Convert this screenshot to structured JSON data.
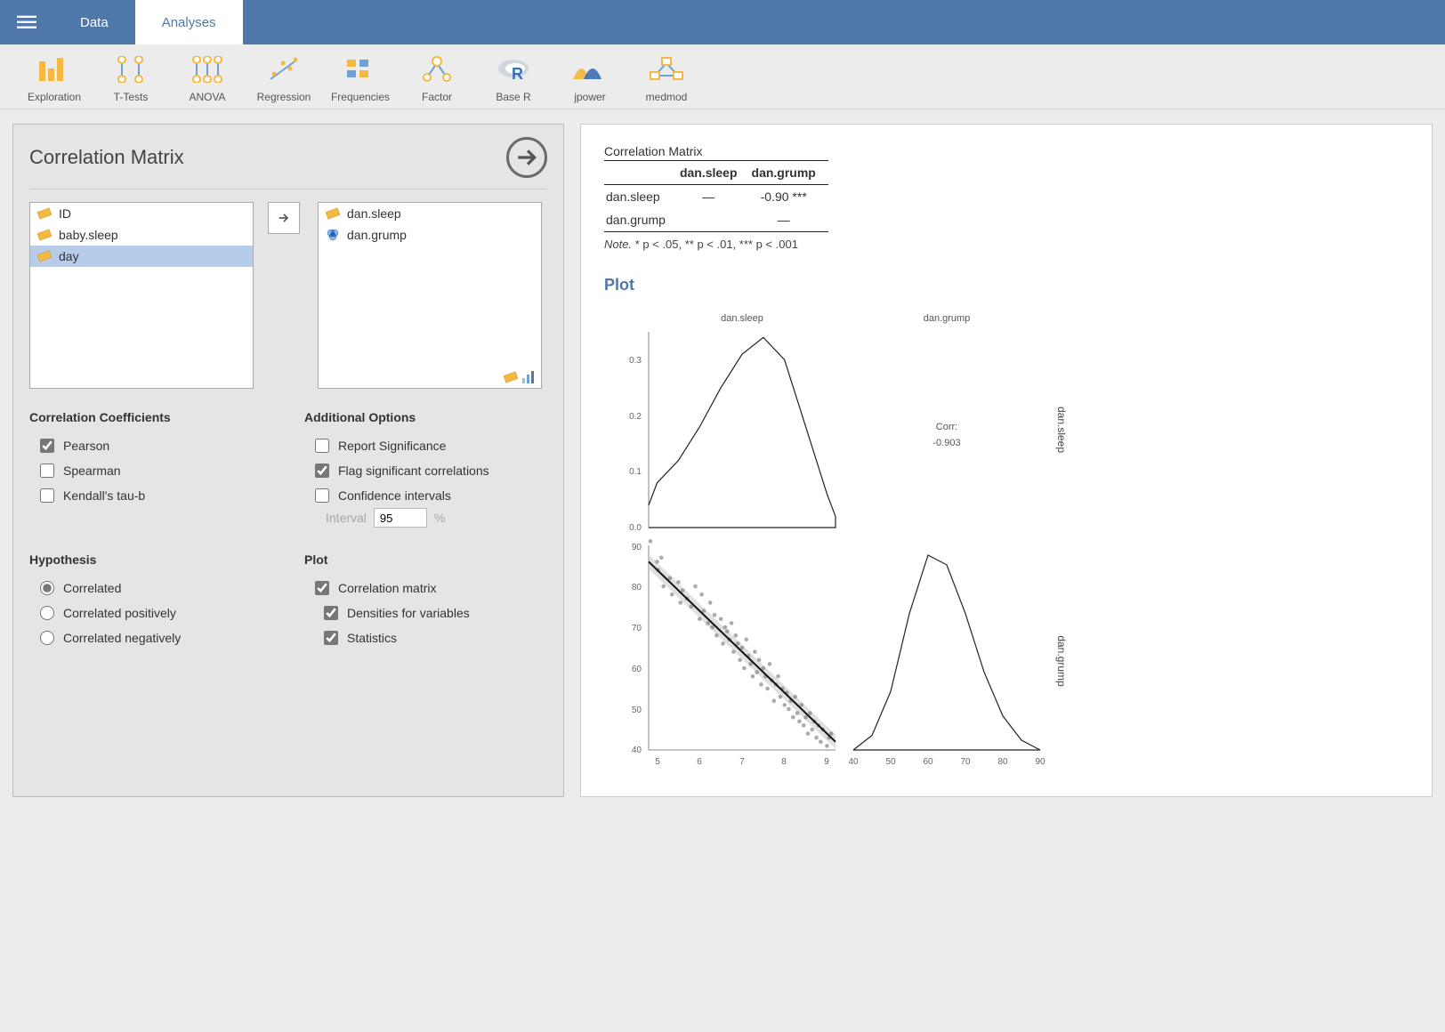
{
  "topbar": {
    "tabs": [
      {
        "label": "Data"
      },
      {
        "label": "Analyses"
      }
    ],
    "active_tab": 1
  },
  "toolbar": [
    {
      "label": "Exploration"
    },
    {
      "label": "T-Tests"
    },
    {
      "label": "ANOVA"
    },
    {
      "label": "Regression"
    },
    {
      "label": "Frequencies"
    },
    {
      "label": "Factor"
    },
    {
      "label": "Base R"
    },
    {
      "label": "jpower"
    },
    {
      "label": "medmod"
    }
  ],
  "analysis": {
    "title": "Correlation Matrix",
    "available_vars": [
      {
        "name": "ID",
        "type": "scale",
        "selected": false
      },
      {
        "name": "baby.sleep",
        "type": "scale",
        "selected": false
      },
      {
        "name": "day",
        "type": "scale",
        "selected": true
      }
    ],
    "selected_vars": [
      {
        "name": "dan.sleep",
        "type": "scale"
      },
      {
        "name": "dan.grump",
        "type": "nominal"
      }
    ],
    "corr_coeff": {
      "header": "Correlation Coefficients",
      "pearson": "Pearson",
      "spearman": "Spearman",
      "kendall": "Kendall's tau-b",
      "pearson_checked": true,
      "spearman_checked": false,
      "kendall_checked": false
    },
    "addl": {
      "header": "Additional Options",
      "report_sig": "Report Significance",
      "flag": "Flag significant correlations",
      "ci": "Confidence intervals",
      "report_sig_checked": false,
      "flag_checked": true,
      "ci_checked": false,
      "interval_label": "Interval",
      "interval_value": "95",
      "interval_suffix": "%"
    },
    "hypothesis": {
      "header": "Hypothesis",
      "correlated": "Correlated",
      "pos": "Correlated positively",
      "neg": "Correlated negatively",
      "selected": "correlated"
    },
    "plot_opts": {
      "header": "Plot",
      "matrix": "Correlation matrix",
      "densities": "Densities for variables",
      "stats": "Statistics",
      "matrix_checked": true,
      "densities_checked": true,
      "stats_checked": true
    }
  },
  "results": {
    "table_title": "Correlation Matrix",
    "cols": [
      "dan.sleep",
      "dan.grump"
    ],
    "rows": [
      {
        "name": "dan.sleep",
        "cells": [
          "—",
          "-0.90 ***"
        ]
      },
      {
        "name": "dan.grump",
        "cells": [
          "",
          "—"
        ]
      }
    ],
    "note_label": "Note.",
    "note_text": "* p < .05, ** p < .01, *** p < .001",
    "plot_heading": "Plot",
    "facet_labels": {
      "x1": "dan.sleep",
      "x2": "dan.grump",
      "y1": "dan.sleep",
      "y2": "dan.grump"
    },
    "corr_label": "Corr:",
    "corr_value": "-0.903"
  },
  "chart_data": [
    {
      "type": "area",
      "role": "density",
      "variable": "dan.sleep",
      "panel": "top-left",
      "x": [
        4.8,
        5.0,
        5.5,
        6.0,
        6.5,
        7.0,
        7.5,
        8.0,
        8.5,
        9.0,
        9.2
      ],
      "y": [
        0.04,
        0.08,
        0.12,
        0.18,
        0.25,
        0.31,
        0.34,
        0.3,
        0.18,
        0.06,
        0.02
      ],
      "xlim": [
        4.8,
        9.2
      ],
      "ylim": [
        0.0,
        0.35
      ],
      "yticks": [
        0.0,
        0.1,
        0.2,
        0.3
      ]
    },
    {
      "type": "area",
      "role": "density",
      "variable": "dan.grump",
      "panel": "bottom-right",
      "x": [
        40,
        45,
        50,
        55,
        60,
        65,
        70,
        75,
        80,
        85,
        90
      ],
      "y": [
        0.0,
        0.003,
        0.012,
        0.028,
        0.04,
        0.038,
        0.028,
        0.016,
        0.007,
        0.002,
        0.0
      ],
      "xlim": [
        40,
        90
      ],
      "ylim": [
        0,
        0.042
      ]
    },
    {
      "type": "scatter",
      "panel": "bottom-left",
      "xvar": "dan.sleep",
      "yvar": "dan.grump",
      "xlim": [
        4.8,
        9.2
      ],
      "ylim": [
        40,
        90
      ],
      "xticks": [
        5,
        6,
        7,
        8,
        9
      ],
      "yticks": [
        40,
        50,
        60,
        70,
        80,
        90
      ],
      "fit": {
        "x": [
          4.8,
          9.2
        ],
        "y": [
          86,
          42
        ]
      },
      "points": [
        [
          4.84,
          91
        ],
        [
          5.0,
          86
        ],
        [
          5.02,
          84
        ],
        [
          5.1,
          87
        ],
        [
          5.15,
          80
        ],
        [
          5.3,
          82
        ],
        [
          5.35,
          78
        ],
        [
          5.5,
          81
        ],
        [
          5.55,
          76
        ],
        [
          5.6,
          79
        ],
        [
          5.7,
          77
        ],
        [
          5.8,
          75
        ],
        [
          5.9,
          80
        ],
        [
          6.0,
          72
        ],
        [
          6.05,
          78
        ],
        [
          6.1,
          74
        ],
        [
          6.2,
          71
        ],
        [
          6.25,
          76
        ],
        [
          6.3,
          70
        ],
        [
          6.35,
          73
        ],
        [
          6.4,
          68
        ],
        [
          6.5,
          72
        ],
        [
          6.55,
          66
        ],
        [
          6.6,
          70
        ],
        [
          6.65,
          69
        ],
        [
          6.7,
          67
        ],
        [
          6.75,
          71
        ],
        [
          6.8,
          64
        ],
        [
          6.85,
          68
        ],
        [
          6.9,
          66
        ],
        [
          6.95,
          62
        ],
        [
          7.0,
          65
        ],
        [
          7.05,
          60
        ],
        [
          7.1,
          67
        ],
        [
          7.15,
          63
        ],
        [
          7.2,
          61
        ],
        [
          7.25,
          58
        ],
        [
          7.3,
          64
        ],
        [
          7.35,
          59
        ],
        [
          7.4,
          62
        ],
        [
          7.45,
          56
        ],
        [
          7.5,
          60
        ],
        [
          7.55,
          58
        ],
        [
          7.6,
          55
        ],
        [
          7.65,
          61
        ],
        [
          7.7,
          57
        ],
        [
          7.75,
          52
        ],
        [
          7.8,
          56
        ],
        [
          7.85,
          58
        ],
        [
          7.9,
          53
        ],
        [
          7.95,
          55
        ],
        [
          8.0,
          51
        ],
        [
          8.05,
          54
        ],
        [
          8.1,
          50
        ],
        [
          8.15,
          52
        ],
        [
          8.2,
          48
        ],
        [
          8.25,
          53
        ],
        [
          8.3,
          49
        ],
        [
          8.35,
          47
        ],
        [
          8.4,
          51
        ],
        [
          8.45,
          46
        ],
        [
          8.5,
          48
        ],
        [
          8.55,
          44
        ],
        [
          8.6,
          49
        ],
        [
          8.65,
          45
        ],
        [
          8.7,
          47
        ],
        [
          8.75,
          43
        ],
        [
          8.8,
          46
        ],
        [
          8.85,
          42
        ],
        [
          8.9,
          45
        ],
        [
          9.0,
          41
        ],
        [
          9.05,
          43
        ],
        [
          9.1,
          44
        ]
      ]
    },
    {
      "type": "text",
      "panel": "top-right",
      "lines": [
        "Corr:",
        "-0.903"
      ]
    }
  ]
}
